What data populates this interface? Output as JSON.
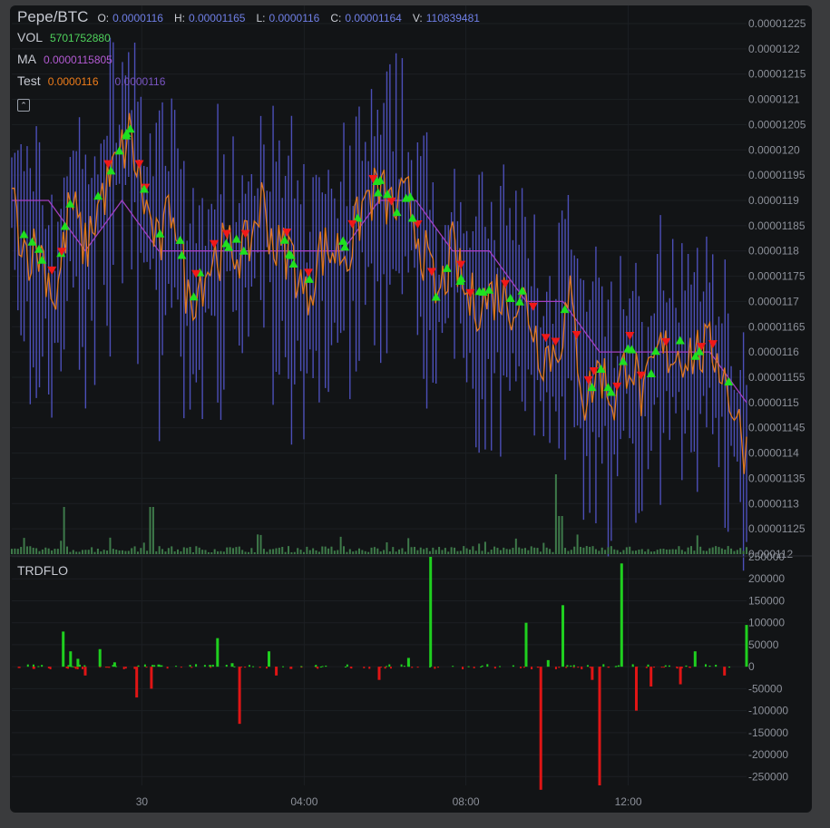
{
  "header": {
    "symbol": "Pepe/BTC",
    "open_label": "O:",
    "open": "0.0000116",
    "high_label": "H:",
    "high": "0.00001165",
    "low_label": "L:",
    "low": "0.0000116",
    "close_label": "C:",
    "close": "0.00001164",
    "volume_label": "V:",
    "volume": "110839481"
  },
  "indicators": {
    "vol_label": "VOL",
    "vol_value": "5701752880",
    "ma_label": "MA",
    "ma_value": "0.0000115805",
    "test_label": "Test",
    "test_value_1": "0.0000116",
    "test_value_2": "0.0000116"
  },
  "collapse_icon": "chevron-up-icon",
  "lower_pane": {
    "title": "TRDFLO"
  },
  "colors": {
    "background": "#121416",
    "candle": "#4c4fb8",
    "test_line": "#e0781e",
    "ma_line": "#a23fbf",
    "buy_marker": "#1fe01f",
    "sell_marker": "#f01818",
    "positive_bar": "#1fcf1f",
    "negative_bar": "#e01515",
    "volume_bar": "#3e7a4a",
    "axis_text": "#8c9099"
  },
  "chart_data": [
    {
      "type": "candlestick",
      "title": "Pepe/BTC",
      "x_ticks": [
        "30",
        "04:00",
        "08:00",
        "12:00"
      ],
      "y_ticks": [
        "0.00001225",
        "0.0000122",
        "0.00001215",
        "0.0000121",
        "0.00001205",
        "0.0000120",
        "0.00001195",
        "0.0000119",
        "0.00001185",
        "0.0000118",
        "0.00001175",
        "0.0000117",
        "0.00001165",
        "0.0000116",
        "0.00001155",
        "0.0000115",
        "0.00001145",
        "0.0000114",
        "0.00001135",
        "0.0000113",
        "0.00001125",
        "0.000112"
      ],
      "ylim": [
        1.12e-05,
        1.225e-05
      ],
      "series": [
        {
          "name": "Test",
          "color": "#e0781e",
          "x": [
            0,
            0.02,
            0.04,
            0.06,
            0.08,
            0.1,
            0.12,
            0.14,
            0.16,
            0.18,
            0.2,
            0.22,
            0.24,
            0.26,
            0.28,
            0.3,
            0.32,
            0.34,
            0.36,
            0.38,
            0.4,
            0.42,
            0.44,
            0.46,
            0.48,
            0.5,
            0.52,
            0.54,
            0.56,
            0.58,
            0.6,
            0.62,
            0.64,
            0.66,
            0.68,
            0.7,
            0.72,
            0.74,
            0.76,
            0.78,
            0.8,
            0.82,
            0.84,
            0.86,
            0.88,
            0.9,
            0.92,
            0.94,
            0.96,
            0.98,
            1.0
          ],
          "y": [
            1.19e-05,
            1.18e-05,
            1.18e-05,
            1.17e-05,
            1.19e-05,
            1.18e-05,
            1.19e-05,
            1.196e-05,
            1.203e-05,
            1.19e-05,
            1.18e-05,
            1.19e-05,
            1.17e-05,
            1.175e-05,
            1.18e-05,
            1.18e-05,
            1.18e-05,
            1.19e-05,
            1.18e-05,
            1.18e-05,
            1.17e-05,
            1.18e-05,
            1.18e-05,
            1.18e-05,
            1.19e-05,
            1.192e-05,
            1.188e-05,
            1.19e-05,
            1.18e-05,
            1.17e-05,
            1.18e-05,
            1.17e-05,
            1.17e-05,
            1.172e-05,
            1.17e-05,
            1.17e-05,
            1.16e-05,
            1.16e-05,
            1.17e-05,
            1.15e-05,
            1.157e-05,
            1.15e-05,
            1.16e-05,
            1.15e-05,
            1.16e-05,
            1.16e-05,
            1.16e-05,
            1.16e-05,
            1.16e-05,
            1.15e-05,
            1.14e-05
          ]
        },
        {
          "name": "MA",
          "color": "#a23fbf",
          "x": [
            0,
            0.05,
            0.1,
            0.15,
            0.2,
            0.25,
            0.3,
            0.35,
            0.4,
            0.45,
            0.5,
            0.55,
            0.6,
            0.65,
            0.7,
            0.75,
            0.8,
            0.85,
            0.9,
            0.95,
            1.0
          ],
          "y": [
            1.19e-05,
            1.19e-05,
            1.18e-05,
            1.19e-05,
            1.18e-05,
            1.18e-05,
            1.18e-05,
            1.18e-05,
            1.18e-05,
            1.18e-05,
            1.19e-05,
            1.19e-05,
            1.18e-05,
            1.18e-05,
            1.17e-05,
            1.17e-05,
            1.16e-05,
            1.16e-05,
            1.16e-05,
            1.16e-05,
            1.15e-05
          ]
        }
      ]
    },
    {
      "type": "bar",
      "title": "TRDFLO",
      "y_ticks": [
        "250000",
        "200000",
        "150000",
        "100000",
        "50000",
        "0",
        "-50000",
        "-100000",
        "-150000",
        "-200000",
        "-250000"
      ],
      "ylim": [
        -270000,
        250000
      ],
      "x": [
        0.01,
        0.03,
        0.07,
        0.08,
        0.09,
        0.1,
        0.12,
        0.14,
        0.17,
        0.19,
        0.2,
        0.27,
        0.28,
        0.3,
        0.31,
        0.35,
        0.36,
        0.38,
        0.5,
        0.54,
        0.57,
        0.7,
        0.72,
        0.73,
        0.75,
        0.79,
        0.8,
        0.83,
        0.85,
        0.87,
        0.91,
        0.93,
        0.97,
        1.0
      ],
      "values": [
        -3000,
        -5000,
        80000,
        35000,
        18000,
        -20000,
        40000,
        10000,
        -70000,
        -50000,
        5000,
        4000,
        65000,
        8000,
        -130000,
        35000,
        -20000,
        -5000,
        -30000,
        20000,
        250000,
        100000,
        -280000,
        15000,
        140000,
        -30000,
        -270000,
        235000,
        -100000,
        -45000,
        -40000,
        35000,
        -20000,
        95000
      ],
      "xlabel": "",
      "ylabel": ""
    }
  ]
}
